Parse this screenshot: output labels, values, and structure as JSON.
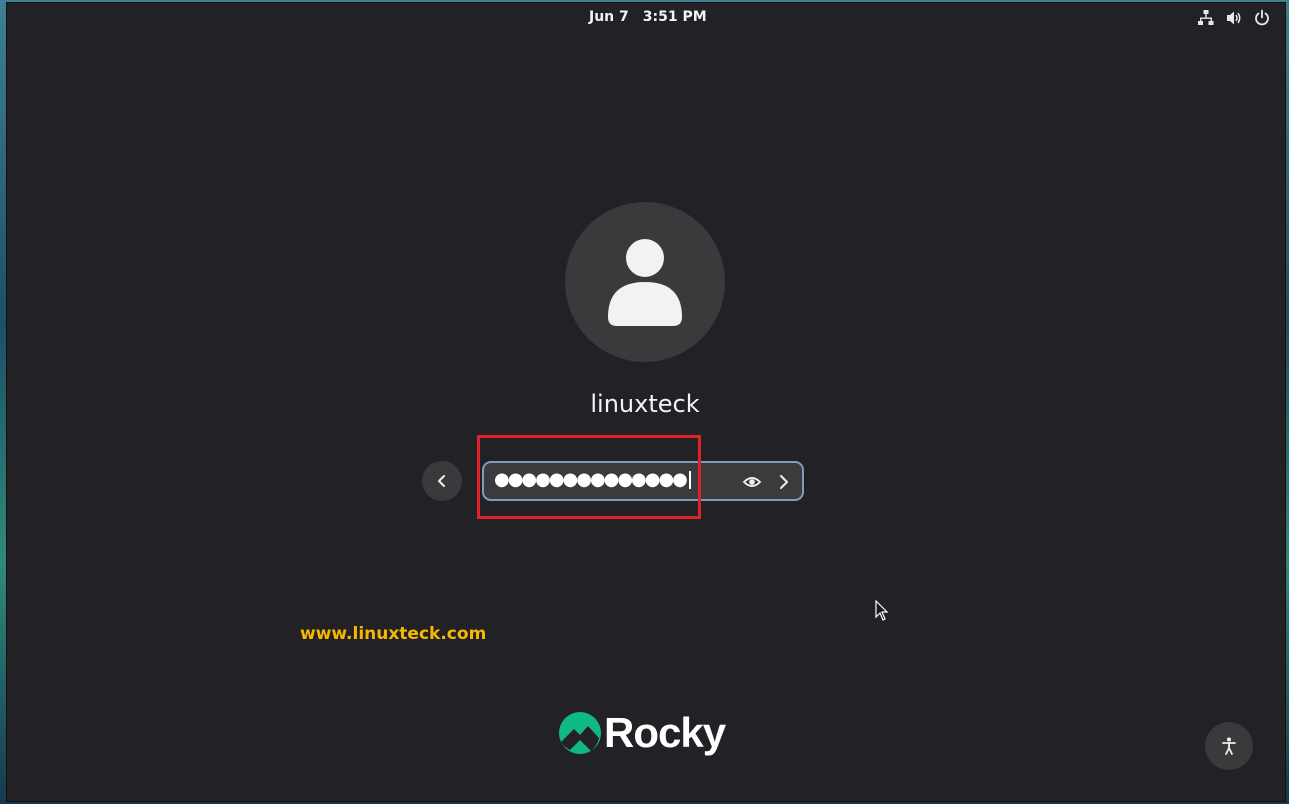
{
  "topbar": {
    "date": "Jun 7",
    "time": "3:51 PM",
    "icons": [
      "network-icon",
      "volume-icon",
      "power-icon"
    ]
  },
  "login": {
    "username": "linuxteck",
    "password_mask": "●●●●●●●●●●●●●●",
    "icons": {
      "back": "chevron-left-icon",
      "reveal": "eye-icon",
      "submit": "chevron-right-icon",
      "avatar": "user-avatar-icon"
    }
  },
  "watermark": "www.linuxteck.com",
  "branding": {
    "logo_text": "Rocky",
    "logo_color": "#10b981"
  },
  "accessibility": {
    "icon": "accessibility-icon"
  },
  "colors": {
    "background": "#222226",
    "highlight": "#e0202a",
    "watermark": "#f5b800",
    "focus_border": "#7e9cc2"
  }
}
